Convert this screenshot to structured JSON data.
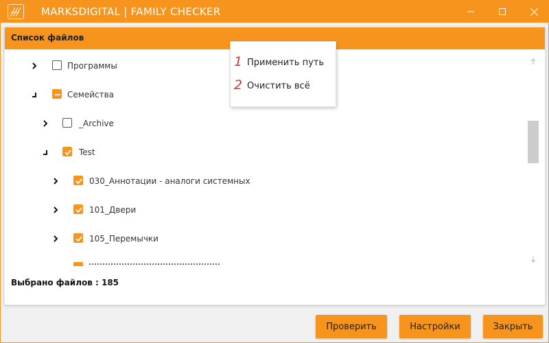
{
  "window": {
    "title": "MARKSDIGITAL | FAMILY CHECKER",
    "accent_color": "#f7941d",
    "logo_icon": "marksdigital-logo-icon",
    "controls": [
      "minimize-icon",
      "maximize-icon",
      "close-icon"
    ]
  },
  "file_list": {
    "title": "Список файлов",
    "tree": [
      {
        "label": "Программы",
        "expanded": false,
        "state": "unchecked"
      },
      {
        "label": "Семейства",
        "expanded": true,
        "state": "partial"
      },
      {
        "label": "_Archive",
        "expanded": false,
        "state": "unchecked"
      },
      {
        "label": "Test",
        "expanded": true,
        "state": "checked"
      },
      {
        "label": "030_Аннотации - аналоги системных",
        "expanded": false,
        "state": "checked"
      },
      {
        "label": "101_Двери",
        "expanded": false,
        "state": "checked"
      },
      {
        "label": "105_Перемычки",
        "expanded": false,
        "state": "checked"
      }
    ],
    "selected_count_text": "Выбрано файлов : 185"
  },
  "context_menu": {
    "items": [
      {
        "number": "1",
        "label": "Применить путь"
      },
      {
        "number": "2",
        "label": "Очистить всё"
      }
    ]
  },
  "buttons": {
    "check": "Проверить",
    "settings": "Настройки",
    "close": "Закрыть"
  }
}
